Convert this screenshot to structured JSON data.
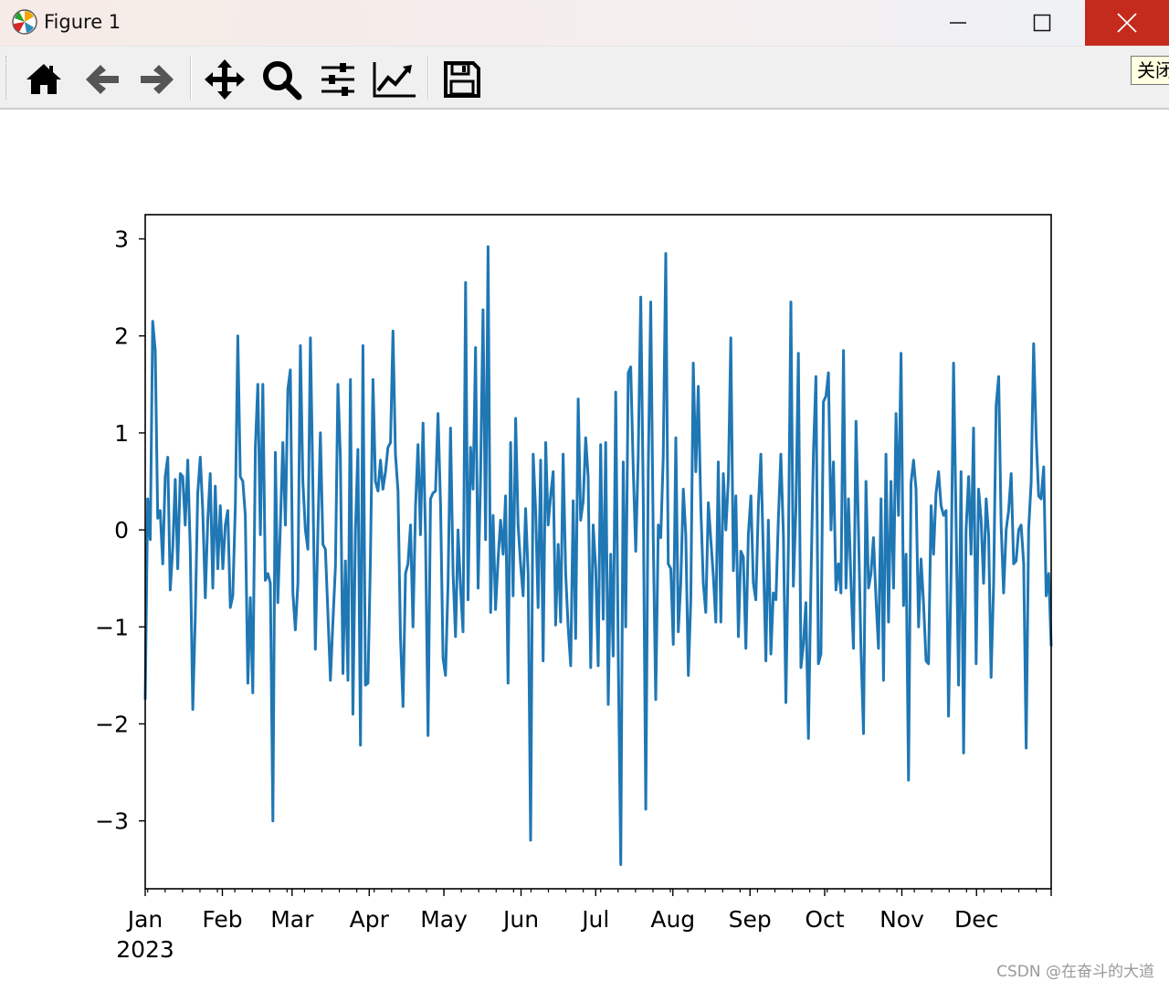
{
  "window": {
    "title": "Figure 1",
    "buttons": [
      {
        "name": "minimize",
        "icon": "minimize-icon"
      },
      {
        "name": "maximize",
        "icon": "maximize-icon"
      },
      {
        "name": "close",
        "icon": "close-icon"
      }
    ],
    "close_bg": "#c42b1c"
  },
  "toolbar": {
    "items": [
      "home-icon",
      "back-arrow-icon",
      "forward-arrow-icon",
      "pan-icon",
      "zoom-icon",
      "configure-subplots-icon",
      "edit-axis-icon",
      "save-icon"
    ],
    "tooltip": "关闭"
  },
  "watermark": "CSDN @在奋斗的大道",
  "chart_data": {
    "type": "line",
    "title": "",
    "xlabel": "",
    "ylabel": "",
    "line_color": "#1f77b4",
    "x_start": "2023-01-01",
    "x_end": "2023-12-31",
    "frequency": "daily",
    "xlim": [
      "2023-01-01",
      "2023-12-31"
    ],
    "ylim": [
      -3.7,
      3.25
    ],
    "yticks": [
      3,
      2,
      1,
      0,
      -1,
      -2,
      -3
    ],
    "ytick_labels": [
      "3",
      "2",
      "1",
      "0",
      "−1",
      "−2",
      "−3"
    ],
    "xtick_labels": [
      "Jan",
      "Feb",
      "Mar",
      "Apr",
      "May",
      "Jun",
      "Jul",
      "Aug",
      "Sep",
      "Oct",
      "Nov",
      "Dec"
    ],
    "xtick_dates": [
      "2023-01-01",
      "2023-02-01",
      "2023-03-01",
      "2023-04-01",
      "2023-05-01",
      "2023-06-01",
      "2023-07-01",
      "2023-08-01",
      "2023-09-01",
      "2023-10-01",
      "2023-11-01",
      "2023-12-01"
    ],
    "year_label": "2023",
    "grid": false,
    "legend": "none",
    "values": [
      -1.75,
      0.32,
      -0.1,
      2.15,
      1.85,
      0.12,
      0.2,
      -0.35,
      0.55,
      0.75,
      -0.62,
      -0.2,
      0.52,
      -0.4,
      0.58,
      0.55,
      0.05,
      0.72,
      -0.2,
      -1.85,
      -0.9,
      0.38,
      0.75,
      0.2,
      -0.7,
      0.1,
      0.58,
      -0.6,
      0.45,
      -0.4,
      0.25,
      -0.4,
      0.05,
      0.2,
      -0.8,
      -0.68,
      0.25,
      2.0,
      0.55,
      0.5,
      0.15,
      -1.58,
      -0.7,
      -1.68,
      0.85,
      1.5,
      -0.05,
      1.5,
      -0.52,
      -0.45,
      -0.55,
      -3.0,
      0.8,
      -0.75,
      0.05,
      0.9,
      0.05,
      1.45,
      1.65,
      -0.65,
      -1.03,
      -0.55,
      1.9,
      0.5,
      0.0,
      -0.2,
      1.98,
      0.45,
      -1.23,
      0.0,
      1.0,
      -0.15,
      -0.2,
      -0.85,
      -1.55,
      -0.95,
      -0.38,
      1.5,
      0.75,
      -1.48,
      -0.32,
      -1.55,
      1.55,
      -1.9,
      0.0,
      0.83,
      -2.22,
      1.9,
      -1.6,
      -1.58,
      -0.3,
      1.55,
      0.5,
      0.4,
      0.72,
      0.42,
      0.6,
      0.85,
      0.9,
      2.05,
      0.78,
      0.4,
      -1.1,
      -1.82,
      -0.45,
      -0.35,
      0.05,
      -1.0,
      0.25,
      0.88,
      -0.05,
      1.1,
      -0.05,
      -2.12,
      0.32,
      0.38,
      0.4,
      1.2,
      0.25,
      -1.32,
      -1.5,
      -0.55,
      1.05,
      -0.45,
      -1.1,
      0.0,
      -0.6,
      -1.05,
      2.55,
      -0.72,
      0.85,
      0.42,
      1.88,
      -0.6,
      0.55,
      2.27,
      -0.1,
      2.92,
      -0.85,
      0.15,
      -0.82,
      -0.3,
      0.1,
      -0.25,
      0.35,
      -1.58,
      0.9,
      -0.68,
      1.15,
      0.05,
      -0.35,
      -0.68,
      0.22,
      -0.45,
      -3.2,
      0.78,
      0.2,
      -0.8,
      0.72,
      -1.35,
      0.9,
      0.05,
      0.35,
      0.6,
      -0.98,
      -0.15,
      -0.95,
      0.78,
      -0.45,
      -1.0,
      -1.4,
      0.3,
      -1.12,
      1.35,
      0.1,
      0.3,
      0.95,
      0.55,
      -1.42,
      0.05,
      -0.4,
      -1.4,
      0.88,
      -0.92,
      0.9,
      -1.8,
      -0.25,
      -1.3,
      1.42,
      -1.25,
      -3.45,
      0.7,
      -1.0,
      1.62,
      1.68,
      0.62,
      -0.22,
      0.75,
      2.4,
      0.38,
      -2.88,
      0.62,
      2.35,
      -0.1,
      -1.75,
      0.05,
      -0.08,
      0.75,
      2.85,
      -0.35,
      -0.4,
      -1.18,
      0.95,
      -1.05,
      -0.55,
      0.42,
      -0.05,
      -1.5,
      -0.72,
      1.72,
      0.6,
      1.48,
      0.22,
      -0.55,
      -0.85,
      0.28,
      -0.1,
      -0.48,
      -0.95,
      0.7,
      -0.95,
      0.58,
      0.0,
      0.52,
      1.98,
      -0.42,
      0.35,
      -1.1,
      -0.22,
      -0.28,
      -1.22,
      -0.05,
      0.35,
      -0.55,
      -0.72,
      0.25,
      0.78,
      -0.28,
      -1.35,
      0.1,
      -1.28,
      -0.65,
      -0.72,
      0.12,
      0.78,
      -0.05,
      -1.78,
      -0.15,
      2.35,
      -0.58,
      0.22,
      1.82,
      -1.42,
      -1.18,
      -0.75,
      -2.15,
      -0.55,
      0.8,
      1.58,
      -1.38,
      -1.28,
      1.32,
      1.38,
      1.62,
      0.0,
      0.7,
      -0.62,
      -0.35,
      -0.65,
      1.85,
      -0.6,
      0.32,
      -0.55,
      -1.22,
      1.12,
      0.0,
      -1.22,
      -2.1,
      0.5,
      -0.6,
      -0.45,
      -0.08,
      -0.72,
      -1.22,
      0.32,
      -1.55,
      0.78,
      -0.95,
      0.5,
      -0.6,
      1.2,
      0.15,
      1.82,
      -0.78,
      -0.25,
      -2.58,
      0.48,
      0.72,
      0.42,
      -1.0,
      -0.3,
      -0.75,
      -1.35,
      -1.38,
      0.25,
      -0.25,
      0.38,
      0.6,
      0.25,
      0.15,
      0.2,
      -1.92,
      -0.42,
      1.72,
      0.05,
      -1.6,
      0.6,
      -2.3,
      0.0,
      0.55,
      -0.25,
      1.05,
      -1.38,
      0.42,
      0.1,
      -0.55,
      0.32,
      -0.05,
      -1.52,
      -0.55,
      1.28,
      1.58,
      0.05,
      -0.65,
      0.0,
      0.2,
      0.58,
      -0.35,
      -0.32,
      0.0,
      0.05,
      -0.35,
      -2.25,
      0.0,
      0.5,
      1.92,
      0.95,
      0.35,
      0.32,
      0.65,
      -0.68,
      -0.45,
      -1.2
    ]
  }
}
